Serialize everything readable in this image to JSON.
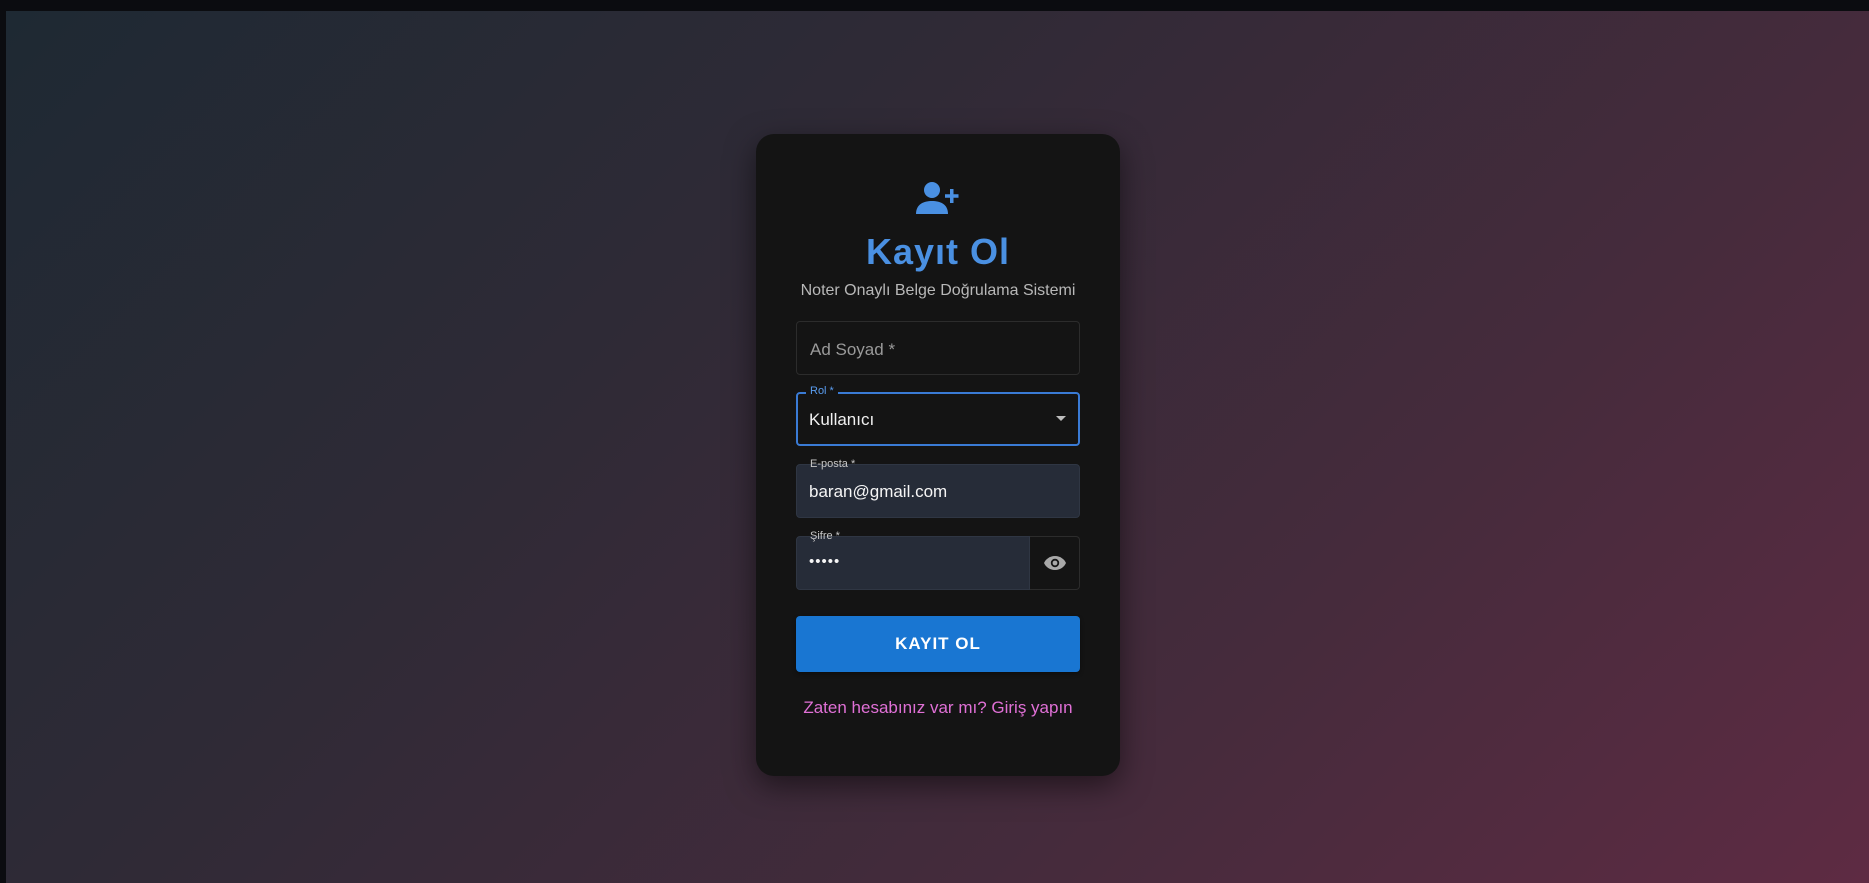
{
  "header": {
    "icon": "person-add-icon",
    "title": "Kayıt Ol",
    "subtitle": "Noter Onaylı Belge Doğrulama Sistemi"
  },
  "form": {
    "name": {
      "placeholder": "Ad Soyad *",
      "value": ""
    },
    "role": {
      "label": "Rol *",
      "value": "Kullanıcı"
    },
    "email": {
      "label": "E-posta *",
      "value": "baran@gmail.com"
    },
    "password": {
      "label": "Şifre *",
      "value": "•••••",
      "toggle_icon": "eye-icon"
    },
    "submit_label": "KAYIT OL",
    "login_link": "Zaten hesabınız var mı? Giriş yapın"
  },
  "colors": {
    "accent": "#4a90e2",
    "button": "#1976d2",
    "link": "#e070d6",
    "card": "#141414"
  }
}
